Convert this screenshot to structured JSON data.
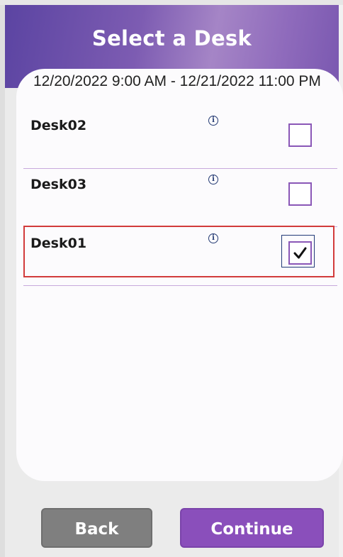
{
  "header": {
    "title": "Select a Desk"
  },
  "booking": {
    "date_range": "12/20/2022 9:00 AM - 12/21/2022 11:00 PM"
  },
  "desks": [
    {
      "name": "Desk02",
      "checked": false
    },
    {
      "name": "Desk03",
      "checked": false
    },
    {
      "name": "Desk01",
      "checked": true
    }
  ],
  "info_icon_glyph": "i",
  "buttons": {
    "back": "Back",
    "continue": "Continue"
  },
  "colors": {
    "accent": "#8a4fbb",
    "checkbox_border": "#8a57b7",
    "back_button": "#7f7f7f",
    "selection_frame": "#d23b3b"
  }
}
